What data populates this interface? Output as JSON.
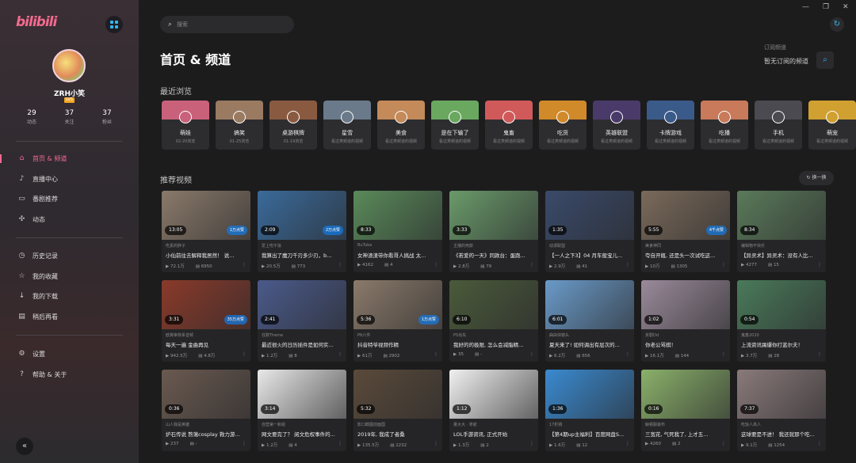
{
  "app": {
    "logo_text": "bilibili",
    "accent": "#f26a8f",
    "blue": "#36b5f0"
  },
  "user": {
    "name": "ZRH小笑",
    "level": "LV5",
    "stats": [
      {
        "num": "29",
        "label": "动态"
      },
      {
        "num": "37",
        "label": "关注"
      },
      {
        "num": "37",
        "label": "粉丝"
      }
    ]
  },
  "nav": {
    "group1": [
      {
        "label": "首页 & 频道",
        "icon": "home-icon",
        "glyph": "⌂",
        "active": true
      },
      {
        "label": "直播中心",
        "icon": "microphone-icon",
        "glyph": "♪",
        "active": false
      },
      {
        "label": "番剧推荐",
        "icon": "tv-icon",
        "glyph": "▭",
        "active": false
      },
      {
        "label": "动态",
        "icon": "activity-icon",
        "glyph": "✣",
        "active": false
      }
    ],
    "group2": [
      {
        "label": "历史记录",
        "icon": "clock-icon",
        "glyph": "◷",
        "active": false
      },
      {
        "label": "我的收藏",
        "icon": "star-icon",
        "glyph": "☆",
        "active": false
      },
      {
        "label": "我的下载",
        "icon": "download-icon",
        "glyph": "↓",
        "active": false
      },
      {
        "label": "稍后再看",
        "icon": "watch-later-icon",
        "glyph": "▤",
        "active": false
      }
    ],
    "group3": [
      {
        "label": "设置",
        "icon": "gear-icon",
        "glyph": "⚙",
        "active": false
      },
      {
        "label": "帮助 & 关于",
        "icon": "help-icon",
        "glyph": "?",
        "active": false
      }
    ]
  },
  "search": {
    "placeholder": "搜索"
  },
  "page_title": "首页 & 频道",
  "subscribed": {
    "label": "订阅频道",
    "value": "暂无订阅的频道"
  },
  "recent": {
    "title": "最近浏览",
    "items": [
      {
        "name": "萌娃",
        "desc": "02-20浏览",
        "color": "#c9617a"
      },
      {
        "name": "搞笑",
        "desc": "01-25浏览",
        "color": "#9a7b62"
      },
      {
        "name": "桌游棋牌",
        "desc": "01-19浏览",
        "color": "#8a5a40"
      },
      {
        "name": "星雪",
        "desc": "看过类频道的视频",
        "color": "#6a7a8a"
      },
      {
        "name": "美食",
        "desc": "看过类频道的视频",
        "color": "#c48a5a"
      },
      {
        "name": "是在下输了",
        "desc": "看过类频道的视频",
        "color": "#6aa860"
      },
      {
        "name": "鬼畜",
        "desc": "看过类频道的视频",
        "color": "#d05a5a"
      },
      {
        "name": "吃货",
        "desc": "看过类频道的视频",
        "color": "#d08a2a"
      },
      {
        "name": "英雄联盟",
        "desc": "看过类频道的视频",
        "color": "#4a3a6a"
      },
      {
        "name": "卡牌游戏",
        "desc": "看过类频道的视频",
        "color": "#3a5a8a"
      },
      {
        "name": "吃播",
        "desc": "看过类频道的视频",
        "color": "#c87a5a"
      },
      {
        "name": "手机",
        "desc": "看过类频道的视频",
        "color": "#4a4a50"
      },
      {
        "name": "萌宠",
        "desc": "看过类频道的视频",
        "color": "#d0a030"
      }
    ]
  },
  "recommend": {
    "title": "推荐视频",
    "shuffle": "换一换"
  },
  "videos": [
    {
      "dur": "13:05",
      "badge": "1万点赞",
      "up": "吃素的胖子",
      "title": "小仙前往去解释我居然！ 说...",
      "views": "72.1万",
      "danmaku": "6950",
      "color": "#8a7a6a"
    },
    {
      "dur": "2:09",
      "badge": "2万点赞",
      "up": "爱上吃午饭",
      "title": "我算出了魔刀千刃多少刃，b...",
      "views": "20.5万",
      "danmaku": "773",
      "color": "#3a6a9a"
    },
    {
      "dur": "8:33",
      "badge": "",
      "up": "BuTuba",
      "title": "女神渣渣带你看哥人挑战 太...",
      "views": "4162",
      "danmaku": "4",
      "color": "#5a8a5a"
    },
    {
      "dur": "3:33",
      "badge": "",
      "up": "主播的死斯",
      "title": "《若爱的一天》同款台：蛋跑...",
      "views": "2.8万",
      "danmaku": "79",
      "color": "#6a9a6a"
    },
    {
      "dur": "1:35",
      "badge": "",
      "up": "动漫联盟",
      "title": "【一人之下3】04 月车般宝儿...",
      "views": "2.9万",
      "danmaku": "41",
      "color": "#3a4a6a"
    },
    {
      "dur": "5:55",
      "badge": "4千点赞",
      "up": "美食神同",
      "title": "夸自开瓶, 还是头一次试吃这...",
      "views": "10万",
      "danmaku": "1305",
      "color": "#7a6a5a"
    },
    {
      "dur": "8:34",
      "badge": "",
      "up": "编辑物不快乐",
      "title": "【异灵术】异灵术：没有人比...",
      "views": "4277",
      "danmaku": "15",
      "color": "#5a7a5a"
    },
    {
      "dur": "3:31",
      "badge": "35万点赞",
      "up": "欧冀审核系音频",
      "title": "每天一遍 金曲再见",
      "views": "942.5万",
      "danmaku": "4.8万",
      "color": "#8a3a2a"
    },
    {
      "dur": "2:41",
      "badge": "",
      "up": "任数Theme",
      "title": "最近很火的日历插件是如何实...",
      "views": "1.2万",
      "danmaku": "8",
      "color": "#4a5a8a"
    },
    {
      "dur": "5:36",
      "badge": "1万点赞",
      "up": "P6六件",
      "title": "抖音特爷视频作精",
      "views": "61万",
      "danmaku": "2902",
      "color": "#8a7a6a"
    },
    {
      "dur": "6:10",
      "badge": "",
      "up": "P5出先",
      "title": "我好的的极限, 怎么会减脂精...",
      "views": "35",
      "danmaku": "-",
      "color": "#4a5a3a"
    },
    {
      "dur": "6:01",
      "badge": "",
      "up": "曲由快镜头",
      "title": "夏天来了! 如何调出有层次的...",
      "views": "6.2万",
      "danmaku": "656",
      "color": "#6a9ac8"
    },
    {
      "dur": "1:02",
      "badge": "",
      "up": "京剧Dd",
      "title": "你老公骂棋！",
      "views": "16.1万",
      "danmaku": "144",
      "color": "#9a8a9a"
    },
    {
      "dur": "0:54",
      "badge": "",
      "up": "鬼畜2020",
      "title": "上流资讯踢爆你打蓝尔夫！",
      "views": "3.7万",
      "danmaku": "28",
      "color": "#4a7a5a"
    },
    {
      "dur": "0:36",
      "badge": "",
      "up": "山人我是英雄",
      "title": "炉石传说 熬蔼cosplay 救力游...",
      "views": "237",
      "danmaku": "-",
      "color": "#6a5a50"
    },
    {
      "dur": "3:14",
      "badge": "",
      "up": "自营第一和组",
      "title": "网文要完了？ 阅文危权事件的...",
      "views": "1.2万",
      "danmaku": "4",
      "color": "#e8e8e8"
    },
    {
      "dur": "5:32",
      "badge": "",
      "up": "影口截图前面国",
      "title": "2019年, 我成了者桑",
      "views": "135.5万",
      "danmaku": "2232",
      "color": "#5a4a3a"
    },
    {
      "dur": "1:12",
      "badge": "",
      "up": "量大大 · 拿航",
      "title": "LOL手游资讯, 正式开始",
      "views": "1.3万",
      "danmaku": "2",
      "color": "#f0f0f0"
    },
    {
      "dur": "1:36",
      "badge": "",
      "up": "17折镜",
      "title": "【第4期up主福利】百度网盘S...",
      "views": "1.6万",
      "danmaku": "12",
      "color": "#3a8ad0"
    },
    {
      "dur": "0:16",
      "badge": "",
      "up": "鲸顿服装布",
      "title": "三宽花, 气死我了, 上才五...",
      "views": "4260",
      "danmaku": "2",
      "color": "#8ab06a"
    },
    {
      "dur": "7:37",
      "badge": "",
      "up": "吃饭人高人",
      "title": "这球要是不进！ 我还就那个吃...",
      "views": "9.1万",
      "danmaku": "1254",
      "color": "#8a7a7a"
    }
  ]
}
